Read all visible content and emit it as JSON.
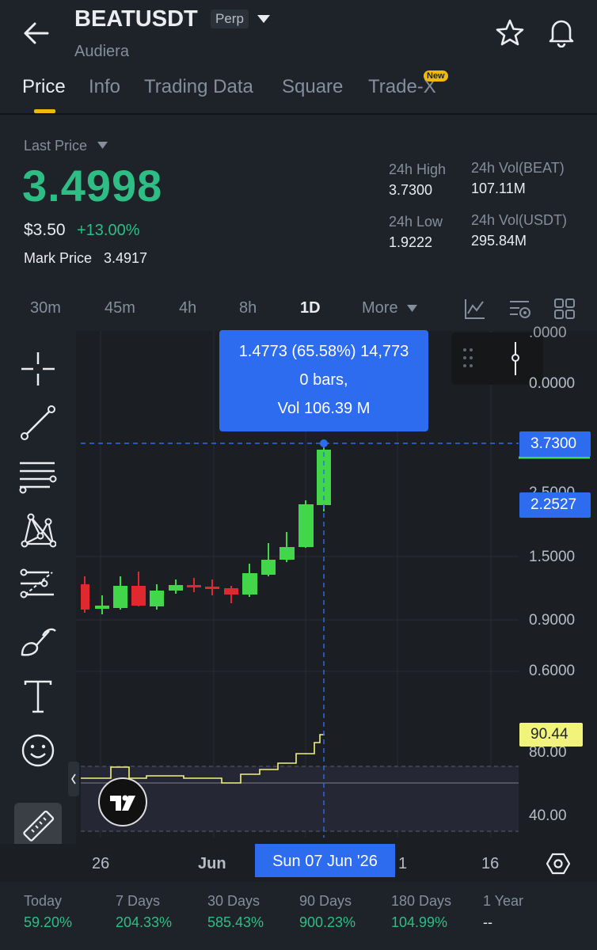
{
  "header": {
    "symbol": "BEATUSDT",
    "badge": "Perp",
    "subtitle": "Audiera"
  },
  "tabs": [
    {
      "label": "Price",
      "active": true
    },
    {
      "label": "Info"
    },
    {
      "label": "Trading Data"
    },
    {
      "label": "Square"
    },
    {
      "label": "Trade-X",
      "badge": "New"
    }
  ],
  "price": {
    "label": "Last Price",
    "last": "3.4998",
    "usd": "$3.50",
    "change": "+13.00%",
    "mark_label": "Mark Price",
    "mark_value": "3.4917"
  },
  "stats": {
    "high_label": "24h High",
    "high": "3.7300",
    "low_label": "24h Low",
    "low": "1.9222",
    "vol_beat_label": "24h Vol(BEAT)",
    "vol_beat": "107.11M",
    "vol_usdt_label": "24h Vol(USDT)",
    "vol_usdt": "295.84M"
  },
  "timeframes": [
    "30m",
    "45m",
    "4h",
    "8h",
    "1D",
    "More"
  ],
  "active_timeframe": "1D",
  "chart": {
    "tooltip_line1": "1.4773 (65.58%) 14,773",
    "tooltip_line2": "0 bars,",
    "tooltip_line3": "Vol 106.39 M",
    "axis_labels": [
      ".0000",
      "0.0000",
      "2.5000",
      "1.5000",
      "0.9000",
      "0.6000",
      "80.00",
      "40.00"
    ],
    "crosshair_price": "3.7300",
    "close_price": "2.2527",
    "indicator_value": "90.44",
    "date_labels": [
      "26",
      "Jun",
      "1",
      "16"
    ],
    "crosshair_date": "Sun 07 Jun '26",
    "colors": {
      "up": "#42d64b",
      "down": "#e0292f",
      "accent": "#2d6bef",
      "indicator": "#f2f37a"
    }
  },
  "periods": [
    {
      "label": "Today",
      "value": "59.20%"
    },
    {
      "label": "7 Days",
      "value": "204.33%"
    },
    {
      "label": "30 Days",
      "value": "585.43%"
    },
    {
      "label": "90 Days",
      "value": "900.23%"
    },
    {
      "label": "180 Days",
      "value": "104.99%"
    },
    {
      "label": "1 Year",
      "value": "--"
    }
  ]
}
